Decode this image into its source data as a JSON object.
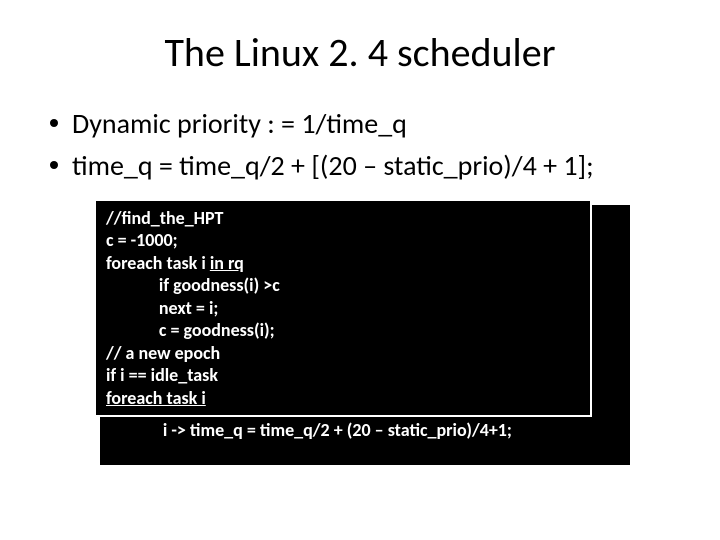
{
  "title": "The Linux 2. 4 scheduler",
  "bullets": [
    "Dynamic priority : = 1/time_q",
    "time_q = time_q/2 + [(20 – static_prio)/4 + 1];"
  ],
  "code": {
    "l1": "//find_the_HPT",
    "l2": "c = -1000;",
    "l3a": "foreach task i ",
    "l3b": "in rq",
    "l4": "             if goodness(i) >c",
    "l5": "             next = i;",
    "l6": "             c = goodness(i);",
    "l7": "// a new epoch",
    "l8": "if i == idle_task",
    "l9": "foreach task i",
    "l10": "             i -> time_q = time_q/2 + (20 – static_prio)/4+1;"
  }
}
